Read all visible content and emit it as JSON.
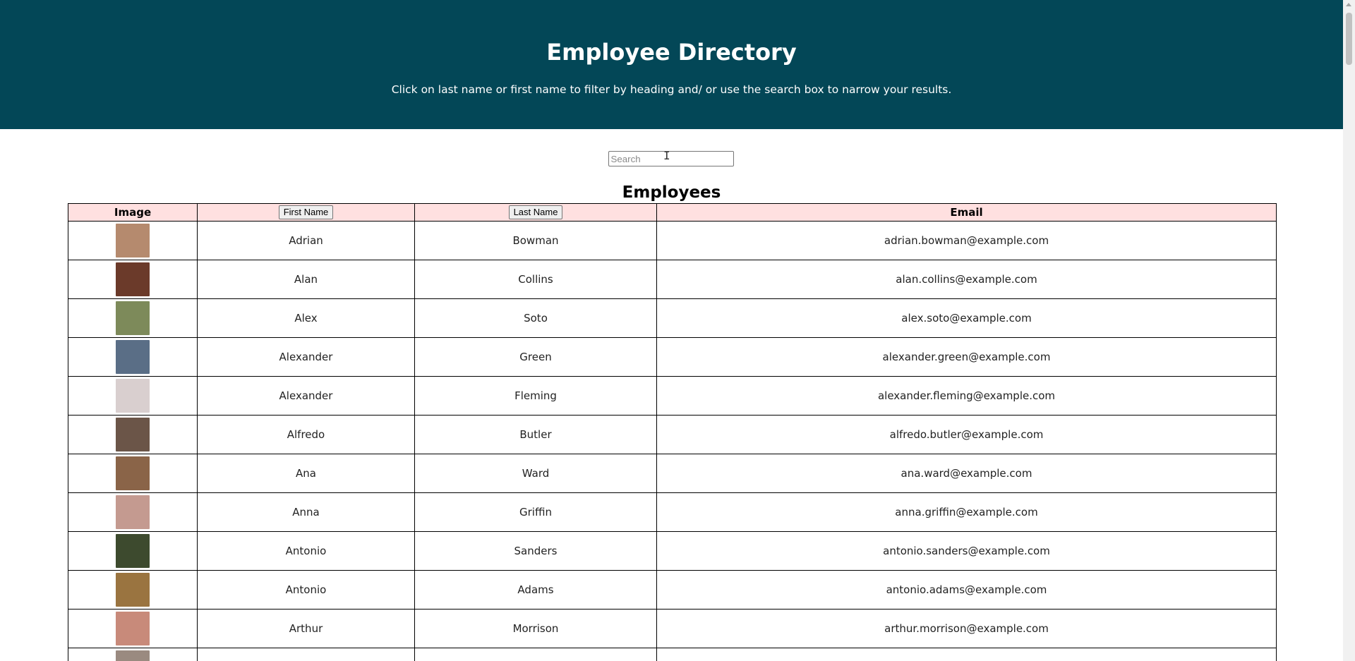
{
  "header": {
    "title": "Employee Directory",
    "subtitle": "Click on last name or first name to filter by heading and/ or use the search box to narrow your results."
  },
  "search": {
    "placeholder": "Search",
    "value": ""
  },
  "table": {
    "title": "Employees",
    "columns": {
      "image": "Image",
      "first_name": "First Name",
      "last_name": "Last Name",
      "email": "Email"
    },
    "rows": [
      {
        "first": "Adrian",
        "last": "Bowman",
        "email": "adrian.bowman@example.com",
        "avatar_color": "#b58a6e"
      },
      {
        "first": "Alan",
        "last": "Collins",
        "email": "alan.collins@example.com",
        "avatar_color": "#6b3a2a"
      },
      {
        "first": "Alex",
        "last": "Soto",
        "email": "alex.soto@example.com",
        "avatar_color": "#7d8a5a"
      },
      {
        "first": "Alexander",
        "last": "Green",
        "email": "alexander.green@example.com",
        "avatar_color": "#5a6e86"
      },
      {
        "first": "Alexander",
        "last": "Fleming",
        "email": "alexander.fleming@example.com",
        "avatar_color": "#d9cfcf"
      },
      {
        "first": "Alfredo",
        "last": "Butler",
        "email": "alfredo.butler@example.com",
        "avatar_color": "#6b5548"
      },
      {
        "first": "Ana",
        "last": "Ward",
        "email": "ana.ward@example.com",
        "avatar_color": "#8a6448"
      },
      {
        "first": "Anna",
        "last": "Griffin",
        "email": "anna.griffin@example.com",
        "avatar_color": "#c49a90"
      },
      {
        "first": "Antonio",
        "last": "Sanders",
        "email": "antonio.sanders@example.com",
        "avatar_color": "#3d4a2e"
      },
      {
        "first": "Antonio",
        "last": "Adams",
        "email": "antonio.adams@example.com",
        "avatar_color": "#9a7440"
      },
      {
        "first": "Arthur",
        "last": "Morrison",
        "email": "arthur.morrison@example.com",
        "avatar_color": "#c88a7a"
      },
      {
        "first": "",
        "last": "",
        "email": "",
        "avatar_color": "#9a8a80"
      }
    ]
  },
  "colors": {
    "header_bg": "#034757",
    "table_header_bg": "#ffe0e0"
  }
}
